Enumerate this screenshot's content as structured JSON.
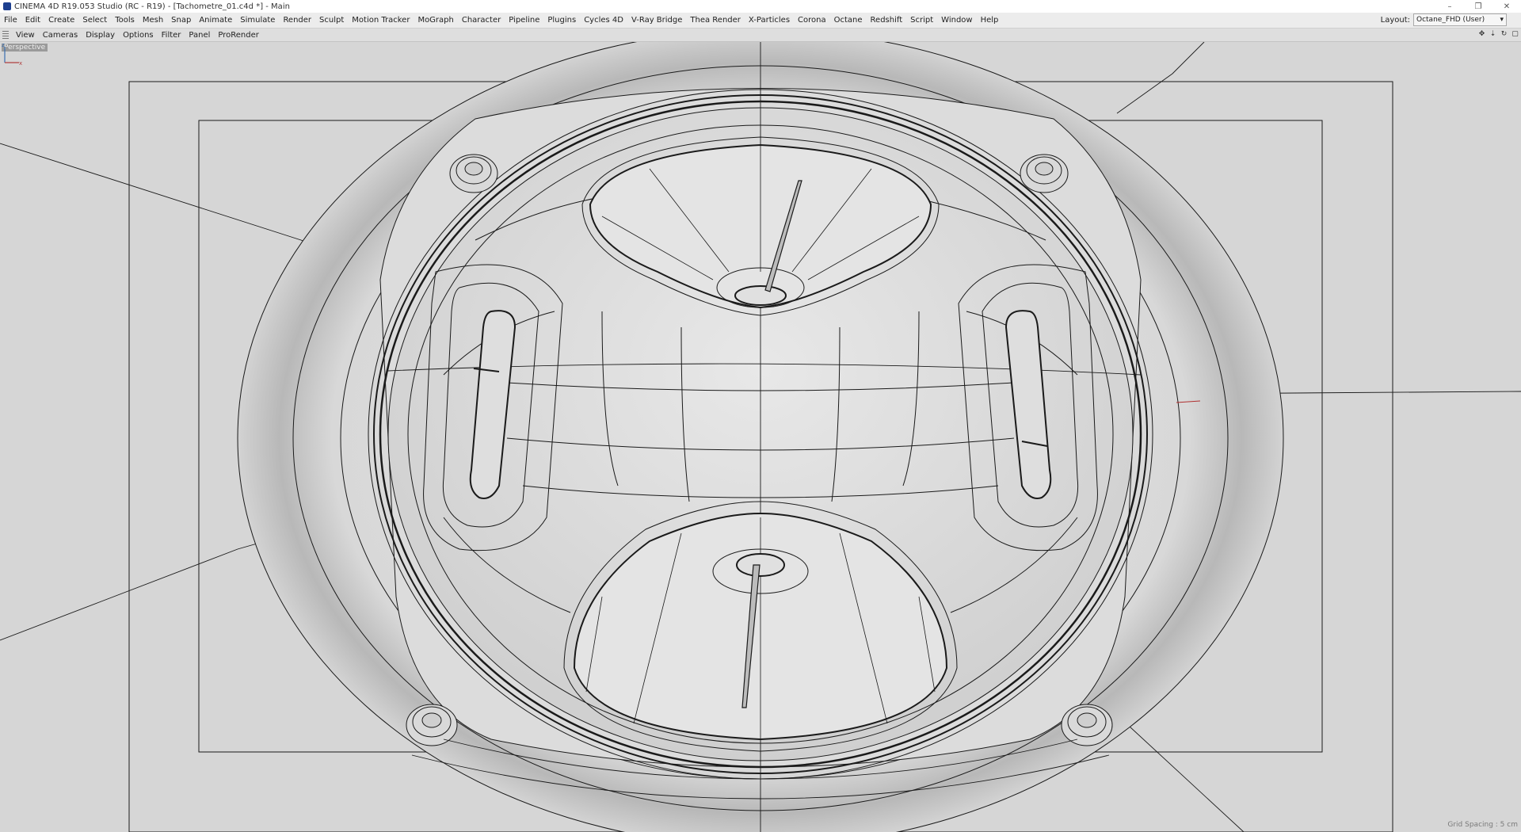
{
  "window": {
    "title": "CINEMA 4D R19.053 Studio (RC - R19) - [Tachometre_01.c4d *] - Main",
    "controls": [
      "–",
      "❐",
      "✕"
    ]
  },
  "menubar": {
    "items": [
      "File",
      "Edit",
      "Create",
      "Select",
      "Tools",
      "Mesh",
      "Snap",
      "Animate",
      "Simulate",
      "Render",
      "Sculpt",
      "Motion Tracker",
      "MoGraph",
      "Character",
      "Pipeline",
      "Plugins",
      "Cycles 4D",
      "V-Ray Bridge",
      "Thea Render",
      "X-Particles",
      "Corona",
      "Octane",
      "Redshift",
      "Script",
      "Window",
      "Help"
    ],
    "layout_label": "Layout:",
    "layout_value": "Octane_FHD (User)"
  },
  "viewbar": {
    "items": [
      "View",
      "Cameras",
      "Display",
      "Options",
      "Filter",
      "Panel",
      "ProRender"
    ],
    "icons": [
      "move-view-icon",
      "zoom-view-icon",
      "rotate-view-icon",
      "toggle-view-icon"
    ]
  },
  "viewport": {
    "label": "Perspective",
    "grid_spacing": "Grid Spacing : 5 cm",
    "axes": {
      "z": "z",
      "x": "x"
    }
  },
  "colors": {
    "viewport_bg": "#d6d6d6",
    "wire": "#1a1a1a",
    "menubar_bg": "#ececec"
  }
}
